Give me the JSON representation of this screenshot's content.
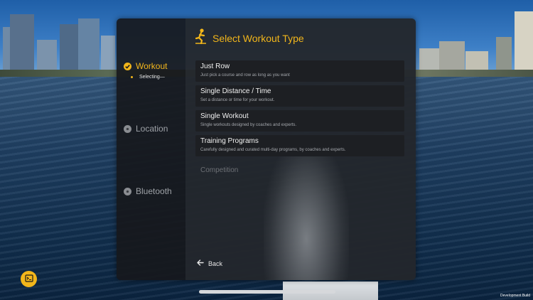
{
  "accent_color": "#f2b61b",
  "steps": [
    {
      "label": "Workout",
      "state": "active",
      "icon": "check-circle-icon"
    },
    {
      "label": "Location",
      "state": "inactive",
      "icon": "dot-circle-icon"
    },
    {
      "label": "Bluetooth",
      "state": "inactive",
      "icon": "dot-circle-icon"
    }
  ],
  "substep": "Selecting—",
  "header": {
    "title": "Select Workout Type",
    "icon": "rower-icon"
  },
  "options": [
    {
      "title": "Just Row",
      "desc": "Just pick a course and row as long as you want"
    },
    {
      "title": "Single Distance / Time",
      "desc": "Set a distance or time for your workout."
    },
    {
      "title": "Single Workout",
      "desc": "Single workouts designed by coaches and experts."
    },
    {
      "title": "Training Programs",
      "desc": "Carefully designed and curated multi-day programs, by coaches and experts."
    }
  ],
  "disabled_option": "Competition",
  "back_label": "Back",
  "dev_label": "Development Build",
  "console_icon": "terminal-icon"
}
